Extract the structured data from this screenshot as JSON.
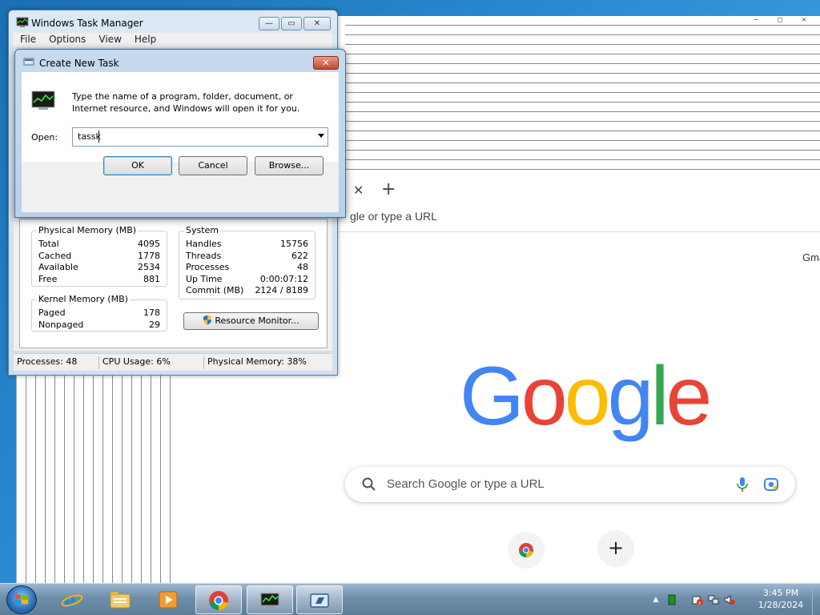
{
  "chrome": {
    "omnibox_partial": "gle or type a URL",
    "tab_close_glyph": "✕",
    "tab_new_glyph": "+",
    "gmail_link": "Gma",
    "logo": [
      "G",
      "o",
      "o",
      "g",
      "l",
      "e"
    ],
    "search_placeholder": "Search Google or type a URL",
    "add_shortcut_glyph": "+",
    "stacked_ctrl_glyphs": [
      "—",
      "□",
      "✕"
    ]
  },
  "task_manager": {
    "title": "Windows Task Manager",
    "window_buttons": {
      "minimize": "—",
      "maximize": "▭",
      "close": "✕"
    },
    "menu": [
      "File",
      "Options",
      "View",
      "Help"
    ],
    "physical_memory": {
      "title": "Physical Memory (MB)",
      "rows": [
        {
          "label": "Total",
          "value": "4095"
        },
        {
          "label": "Cached",
          "value": "1778"
        },
        {
          "label": "Available",
          "value": "2534"
        },
        {
          "label": "Free",
          "value": "881"
        }
      ]
    },
    "system": {
      "title": "System",
      "rows": [
        {
          "label": "Handles",
          "value": "15756"
        },
        {
          "label": "Threads",
          "value": "622"
        },
        {
          "label": "Processes",
          "value": "48"
        },
        {
          "label": "Up Time",
          "value": "0:00:07:12"
        },
        {
          "label": "Commit (MB)",
          "value": "2124 / 8189"
        }
      ]
    },
    "kernel_memory": {
      "title": "Kernel Memory (MB)",
      "rows": [
        {
          "label": "Paged",
          "value": "178"
        },
        {
          "label": "Nonpaged",
          "value": "29"
        }
      ]
    },
    "resource_monitor_button": "Resource Monitor...",
    "status": {
      "processes": "Processes: 48",
      "cpu": "CPU Usage: 6%",
      "memory": "Physical Memory: 38%"
    }
  },
  "create_task_dialog": {
    "title": "Create New Task",
    "close_glyph": "✕",
    "description": "Type the name of a program, folder, document, or Internet resource, and Windows will open it for you.",
    "open_label": "Open:",
    "open_value": "tassk",
    "buttons": {
      "ok": "OK",
      "cancel": "Cancel",
      "browse": "Browse..."
    }
  },
  "taskbar": {
    "clock_time": "3:45 PM",
    "clock_date": "1/28/2024",
    "tray_arrow": "▲"
  },
  "colors": {
    "google_blue": "#4285f4",
    "google_red": "#ea4335",
    "google_yellow": "#fbbc05",
    "google_green": "#34a853",
    "win7_title": "#cfdfee"
  }
}
